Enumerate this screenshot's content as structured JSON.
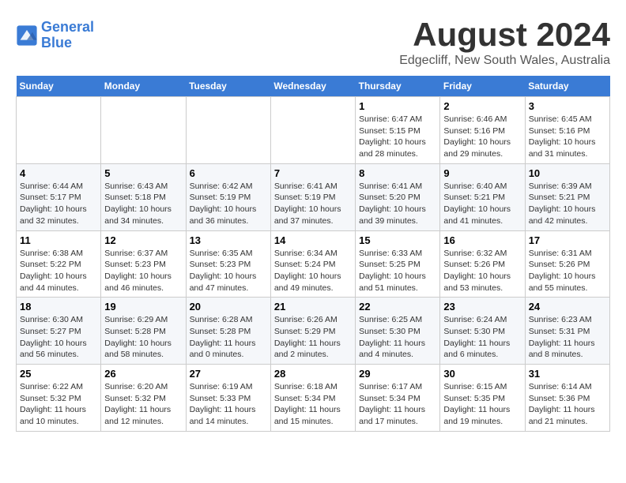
{
  "logo": {
    "line1": "General",
    "line2": "Blue"
  },
  "title": "August 2024",
  "subtitle": "Edgecliff, New South Wales, Australia",
  "days_of_week": [
    "Sunday",
    "Monday",
    "Tuesday",
    "Wednesday",
    "Thursday",
    "Friday",
    "Saturday"
  ],
  "weeks": [
    [
      {
        "day": "",
        "info": ""
      },
      {
        "day": "",
        "info": ""
      },
      {
        "day": "",
        "info": ""
      },
      {
        "day": "",
        "info": ""
      },
      {
        "day": "1",
        "info": "Sunrise: 6:47 AM\nSunset: 5:15 PM\nDaylight: 10 hours\nand 28 minutes."
      },
      {
        "day": "2",
        "info": "Sunrise: 6:46 AM\nSunset: 5:16 PM\nDaylight: 10 hours\nand 29 minutes."
      },
      {
        "day": "3",
        "info": "Sunrise: 6:45 AM\nSunset: 5:16 PM\nDaylight: 10 hours\nand 31 minutes."
      }
    ],
    [
      {
        "day": "4",
        "info": "Sunrise: 6:44 AM\nSunset: 5:17 PM\nDaylight: 10 hours\nand 32 minutes."
      },
      {
        "day": "5",
        "info": "Sunrise: 6:43 AM\nSunset: 5:18 PM\nDaylight: 10 hours\nand 34 minutes."
      },
      {
        "day": "6",
        "info": "Sunrise: 6:42 AM\nSunset: 5:19 PM\nDaylight: 10 hours\nand 36 minutes."
      },
      {
        "day": "7",
        "info": "Sunrise: 6:41 AM\nSunset: 5:19 PM\nDaylight: 10 hours\nand 37 minutes."
      },
      {
        "day": "8",
        "info": "Sunrise: 6:41 AM\nSunset: 5:20 PM\nDaylight: 10 hours\nand 39 minutes."
      },
      {
        "day": "9",
        "info": "Sunrise: 6:40 AM\nSunset: 5:21 PM\nDaylight: 10 hours\nand 41 minutes."
      },
      {
        "day": "10",
        "info": "Sunrise: 6:39 AM\nSunset: 5:21 PM\nDaylight: 10 hours\nand 42 minutes."
      }
    ],
    [
      {
        "day": "11",
        "info": "Sunrise: 6:38 AM\nSunset: 5:22 PM\nDaylight: 10 hours\nand 44 minutes."
      },
      {
        "day": "12",
        "info": "Sunrise: 6:37 AM\nSunset: 5:23 PM\nDaylight: 10 hours\nand 46 minutes."
      },
      {
        "day": "13",
        "info": "Sunrise: 6:35 AM\nSunset: 5:23 PM\nDaylight: 10 hours\nand 47 minutes."
      },
      {
        "day": "14",
        "info": "Sunrise: 6:34 AM\nSunset: 5:24 PM\nDaylight: 10 hours\nand 49 minutes."
      },
      {
        "day": "15",
        "info": "Sunrise: 6:33 AM\nSunset: 5:25 PM\nDaylight: 10 hours\nand 51 minutes."
      },
      {
        "day": "16",
        "info": "Sunrise: 6:32 AM\nSunset: 5:26 PM\nDaylight: 10 hours\nand 53 minutes."
      },
      {
        "day": "17",
        "info": "Sunrise: 6:31 AM\nSunset: 5:26 PM\nDaylight: 10 hours\nand 55 minutes."
      }
    ],
    [
      {
        "day": "18",
        "info": "Sunrise: 6:30 AM\nSunset: 5:27 PM\nDaylight: 10 hours\nand 56 minutes."
      },
      {
        "day": "19",
        "info": "Sunrise: 6:29 AM\nSunset: 5:28 PM\nDaylight: 10 hours\nand 58 minutes."
      },
      {
        "day": "20",
        "info": "Sunrise: 6:28 AM\nSunset: 5:28 PM\nDaylight: 11 hours\nand 0 minutes."
      },
      {
        "day": "21",
        "info": "Sunrise: 6:26 AM\nSunset: 5:29 PM\nDaylight: 11 hours\nand 2 minutes."
      },
      {
        "day": "22",
        "info": "Sunrise: 6:25 AM\nSunset: 5:30 PM\nDaylight: 11 hours\nand 4 minutes."
      },
      {
        "day": "23",
        "info": "Sunrise: 6:24 AM\nSunset: 5:30 PM\nDaylight: 11 hours\nand 6 minutes."
      },
      {
        "day": "24",
        "info": "Sunrise: 6:23 AM\nSunset: 5:31 PM\nDaylight: 11 hours\nand 8 minutes."
      }
    ],
    [
      {
        "day": "25",
        "info": "Sunrise: 6:22 AM\nSunset: 5:32 PM\nDaylight: 11 hours\nand 10 minutes."
      },
      {
        "day": "26",
        "info": "Sunrise: 6:20 AM\nSunset: 5:32 PM\nDaylight: 11 hours\nand 12 minutes."
      },
      {
        "day": "27",
        "info": "Sunrise: 6:19 AM\nSunset: 5:33 PM\nDaylight: 11 hours\nand 14 minutes."
      },
      {
        "day": "28",
        "info": "Sunrise: 6:18 AM\nSunset: 5:34 PM\nDaylight: 11 hours\nand 15 minutes."
      },
      {
        "day": "29",
        "info": "Sunrise: 6:17 AM\nSunset: 5:34 PM\nDaylight: 11 hours\nand 17 minutes."
      },
      {
        "day": "30",
        "info": "Sunrise: 6:15 AM\nSunset: 5:35 PM\nDaylight: 11 hours\nand 19 minutes."
      },
      {
        "day": "31",
        "info": "Sunrise: 6:14 AM\nSunset: 5:36 PM\nDaylight: 11 hours\nand 21 minutes."
      }
    ]
  ]
}
